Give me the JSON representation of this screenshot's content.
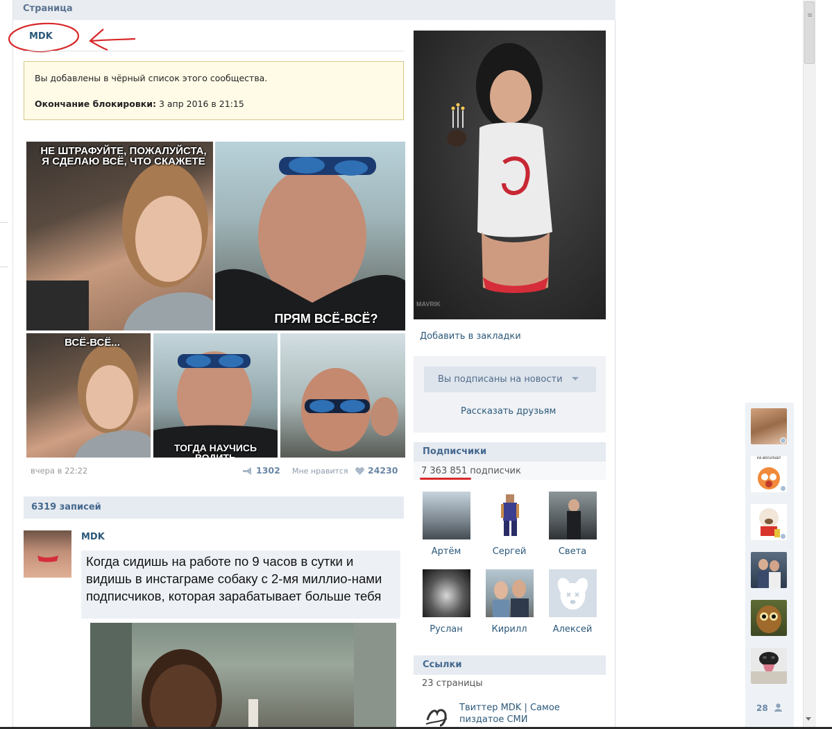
{
  "page": {
    "header_title": "Страница",
    "group_name": "MDK"
  },
  "ban_notice": {
    "message": "Вы добавлены в чёрный список этого сообщества.",
    "end_label": "Окончание блокировки:",
    "end_value": "3 апр 2016 в 21:15"
  },
  "pinned_post": {
    "captions": {
      "top_left": "НЕ ШТРАФУЙТЕ, ПОЖАЛУЙСТА, Я СДЕЛАЮ ВСЁ, ЧТО СКАЖЕТЕ",
      "top_right": "ПРЯМ ВСЁ-ВСЁ?",
      "bottom_left": "ВСЁ-ВСЁ...",
      "bottom_middle": "ТОГДА НАУЧИСЬ ВОДИТЬ"
    },
    "time": "вчера в 22:22",
    "reposts": "1302",
    "likes_label": "Мне нравится",
    "likes": "24230"
  },
  "wall": {
    "header": "6319 записей",
    "post_author": "MDK",
    "post_text": "Когда сидишь на работе по 9 часов в сутки и видишь в инстаграме собаку с 2-мя миллио-нами подписчиков, которая зарабатывает больше тебя"
  },
  "sidebar": {
    "cover_watermark": "MAVRIK",
    "bookmark": "Добавить в закладки",
    "subscribed_button": "Вы подписаны на новости",
    "tell_friends": "Рассказать друзьям",
    "subscribers_header": "Подписчики",
    "subscribers_count": "7 363 851 подписчик",
    "members": [
      {
        "name": "Артём"
      },
      {
        "name": "Сергей"
      },
      {
        "name": "Света"
      },
      {
        "name": "Руслан"
      },
      {
        "name": "Кирилл"
      },
      {
        "name": "Алексей"
      }
    ],
    "links_header": "Ссылки",
    "links_count": "23 страницы",
    "link_title": "Твиттер MDK | Самое пиздатое СМИ"
  },
  "friends_strip": {
    "count": "28",
    "meme_caption": "ка восилиал"
  },
  "colors": {
    "link": "#2b587a",
    "header_bg": "#e6ebf1",
    "annotation_red": "#d8282a"
  }
}
